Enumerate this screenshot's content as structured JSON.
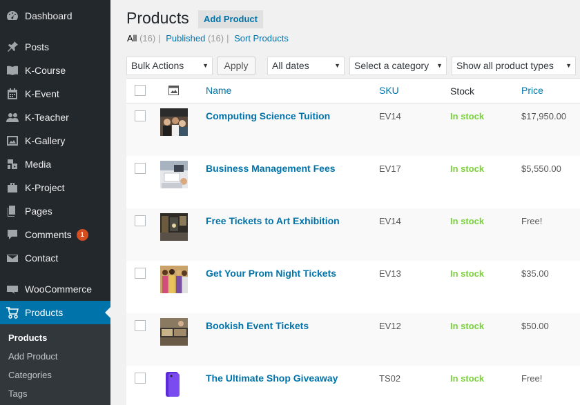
{
  "sidebar": {
    "items": [
      {
        "label": "Dashboard",
        "icon": "dashboard-icon"
      },
      {
        "label": "Posts",
        "icon": "pushpin-icon"
      },
      {
        "label": "K-Course",
        "icon": "book-icon"
      },
      {
        "label": "K-Event",
        "icon": "calendar-icon"
      },
      {
        "label": "K-Teacher",
        "icon": "users-icon"
      },
      {
        "label": "K-Gallery",
        "icon": "image-icon"
      },
      {
        "label": "Media",
        "icon": "media-icon"
      },
      {
        "label": "K-Project",
        "icon": "briefcase-icon"
      },
      {
        "label": "Pages",
        "icon": "pages-icon"
      },
      {
        "label": "Comments",
        "icon": "comment-icon",
        "badge": "1"
      },
      {
        "label": "Contact",
        "icon": "envelope-icon"
      },
      {
        "label": "WooCommerce",
        "icon": "woo-icon"
      },
      {
        "label": "Products",
        "icon": "cart-icon"
      }
    ],
    "submenu": [
      "Products",
      "Add Product",
      "Categories",
      "Tags"
    ]
  },
  "header": {
    "title": "Products",
    "add_button": "Add Product"
  },
  "filters": {
    "all": "All",
    "all_count": "(16)",
    "published": "Published",
    "published_count": "(16)",
    "sort": "Sort Products",
    "bulk_actions": "Bulk Actions",
    "apply": "Apply",
    "dates": "All dates",
    "category": "Select a category",
    "types": "Show all product types"
  },
  "table": {
    "columns": {
      "name": "Name",
      "sku": "SKU",
      "stock": "Stock",
      "price": "Price"
    },
    "rows": [
      {
        "name": "Computing Science Tuition",
        "sku": "EV14",
        "stock": "In stock",
        "price": "$17,950.00"
      },
      {
        "name": "Business Management Fees",
        "sku": "EV17",
        "stock": "In stock",
        "price": "$5,550.00"
      },
      {
        "name": "Free Tickets to Art Exhibition",
        "sku": "EV14",
        "stock": "In stock",
        "price": "Free!"
      },
      {
        "name": "Get Your Prom Night Tickets",
        "sku": "EV13",
        "stock": "In stock",
        "price": "$35.00"
      },
      {
        "name": "Bookish Event Tickets",
        "sku": "EV12",
        "stock": "In stock",
        "price": "$50.00"
      },
      {
        "name": "The Ultimate Shop Giveaway",
        "sku": "TS02",
        "stock": "In stock",
        "price": "Free!"
      }
    ]
  },
  "colors": {
    "sidebar_bg": "#23282d",
    "accent": "#0073aa",
    "in_stock": "#7ad03a",
    "badge": "#d54e21"
  }
}
